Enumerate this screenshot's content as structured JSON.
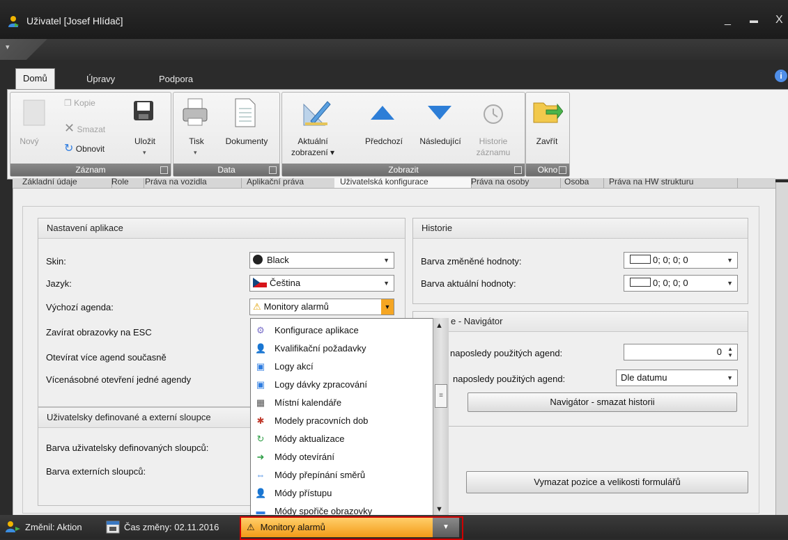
{
  "window": {
    "title": "Uživatel [Josef Hlídač]",
    "minimize": "_",
    "maximize": "▬",
    "close": "X"
  },
  "qat": {
    "dropdown": "▾"
  },
  "tabs": [
    {
      "label": "Domů",
      "active": true
    },
    {
      "label": "Úpravy",
      "active": false
    },
    {
      "label": "Podpora",
      "active": false
    }
  ],
  "info_glyph": "i",
  "ribbon": {
    "groups": [
      {
        "label": "Záznam"
      },
      {
        "label": "Data"
      },
      {
        "label": "Zobrazit"
      },
      {
        "label": "Okno"
      }
    ],
    "buttons": {
      "novy": "Nový",
      "kopie": "Kopie",
      "smazat": "Smazat",
      "obnovit": "Obnovit",
      "ulozit": "Uložit",
      "tisk": "Tisk",
      "dokumenty": "Dokumenty",
      "aktualni_1": "Aktuální",
      "aktualni_2": "zobrazení ▾",
      "predchozi": "Předchozí",
      "nasledujici": "Následující",
      "historie_1": "Historie",
      "historie_2": "záznamu",
      "zavrit": "Zavřít"
    }
  },
  "subtabs": [
    {
      "label": "Základní údaje"
    },
    {
      "label": "Role"
    },
    {
      "label": "Práva na vozidla"
    },
    {
      "label": "Aplikační práva"
    },
    {
      "label": "Uživatelská konfigurace",
      "active": true
    },
    {
      "label": "Práva na osoby"
    },
    {
      "label": "Osoba"
    },
    {
      "label": "Práva na HW strukturu"
    }
  ],
  "settings_panel": {
    "title": "Nastavení aplikace",
    "skin_label": "Skin:",
    "skin_value": "Black",
    "lang_label": "Jazyk:",
    "lang_value": "Čeština",
    "agenda_label": "Výchozí agenda:",
    "agenda_value": "Monitory alarmů",
    "esc_label": "Zavírat obrazovky na ESC",
    "multi_label": "Otevírat více agend současně",
    "repeat_label": "Vícenásobné otevření jedné agendy"
  },
  "columns_panel": {
    "title": "Uživatelsky definované a externí sloupce",
    "user_color_label": "Barva uživatelsky definovaných sloupců:",
    "ext_color_label": "Barva externích sloupců:"
  },
  "history_panel": {
    "title": "Historie",
    "changed_label": "Barva změněné hodnoty:",
    "changed_value": "0; 0; 0; 0",
    "current_label": "Barva aktuální hodnoty:",
    "current_value": "0; 0; 0; 0"
  },
  "navigator_panel": {
    "title_partial": "e - Navigátor",
    "count_label": "naposledy použitých agend:",
    "count_value": "0",
    "sort_label": "naposledy použitých agend:",
    "sort_value": "Dle datumu",
    "clear_button": "Navigátor - smazat historii"
  },
  "reset_button": "Vymazat pozice a velikosti formulářů",
  "dropdown_items": [
    {
      "label": "Konfigurace aplikace",
      "icon": "gear-icon",
      "glyph": "⚙"
    },
    {
      "label": "Kvalifikační požadavky",
      "icon": "user-icon",
      "glyph": "👤"
    },
    {
      "label": "Logy akcí",
      "icon": "window-icon",
      "glyph": "▣"
    },
    {
      "label": "Logy dávky zpracování",
      "icon": "window-icon",
      "glyph": "▣"
    },
    {
      "label": "Místní kalendáře",
      "icon": "calendar-icon",
      "glyph": "▦"
    },
    {
      "label": "Modely pracovních dob",
      "icon": "network-icon",
      "glyph": "✱"
    },
    {
      "label": "Módy aktualizace",
      "icon": "refresh-icon",
      "glyph": "↻"
    },
    {
      "label": "Módy otevírání",
      "icon": "open-icon",
      "glyph": "➜"
    },
    {
      "label": "Módy přepínání směrů",
      "icon": "swap-icon",
      "glyph": "⇔"
    },
    {
      "label": "Módy přístupu",
      "icon": "user-icon",
      "glyph": "👤"
    },
    {
      "label": "Módy spořiče obrazovky",
      "icon": "monitor-icon",
      "glyph": "▬"
    }
  ],
  "edit_combo_value": "Monitory alarmů",
  "statusbar": {
    "changed_by": "Změnil: Aktion",
    "changed_time": "Čas změny: 02.11.2016"
  },
  "colors": {
    "accent_orange": "#f39a17",
    "highlight_red": "#d00000",
    "dark_chrome": "#2b2b2b"
  }
}
